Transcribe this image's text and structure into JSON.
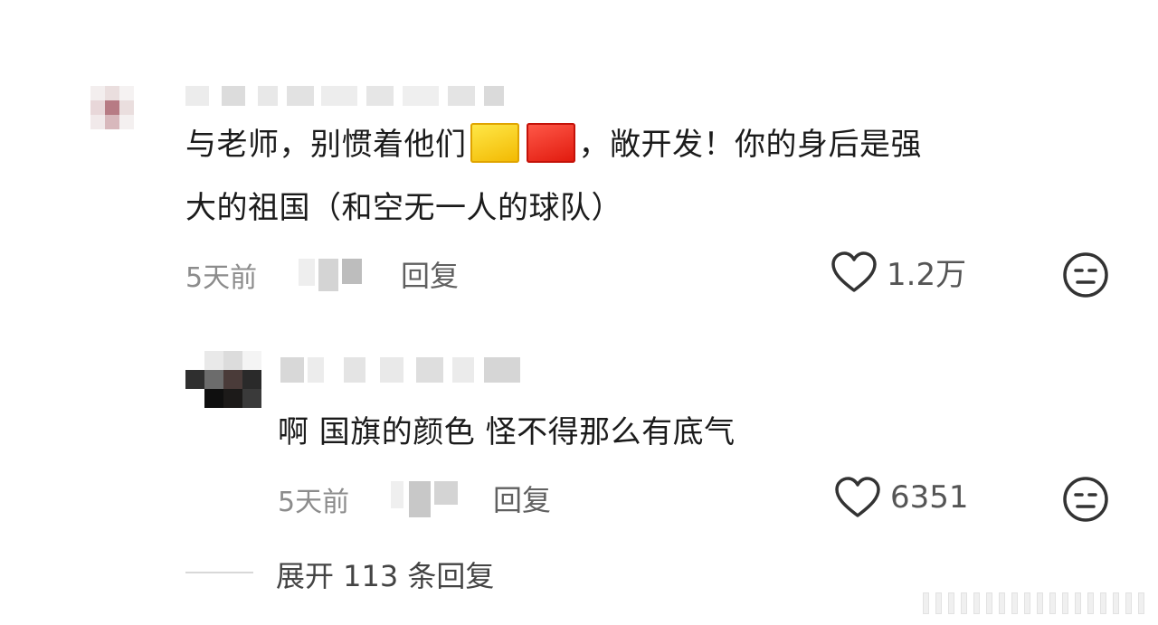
{
  "comments": [
    {
      "text_line1_a": "与老师，别惯着他们",
      "text_line1_b": "，敞开发！你的身后是强",
      "text_line2": "大的祖国（和空无一人的球队）",
      "time": "5天前",
      "reply_label": "回复",
      "likes": "1.2万"
    },
    {
      "text": "啊 国旗的颜色 怪不得那么有底气",
      "time": "5天前",
      "reply_label": "回复",
      "likes": "6351"
    }
  ],
  "expand_label": "展开 113 条回复",
  "colors": {
    "flag_yellow": "#f5c400",
    "flag_red": "#e8221a",
    "meta_gray": "#8c8c8c"
  },
  "icons": {
    "like": "heart-outline-icon",
    "reaction": "neutral-face-icon"
  }
}
